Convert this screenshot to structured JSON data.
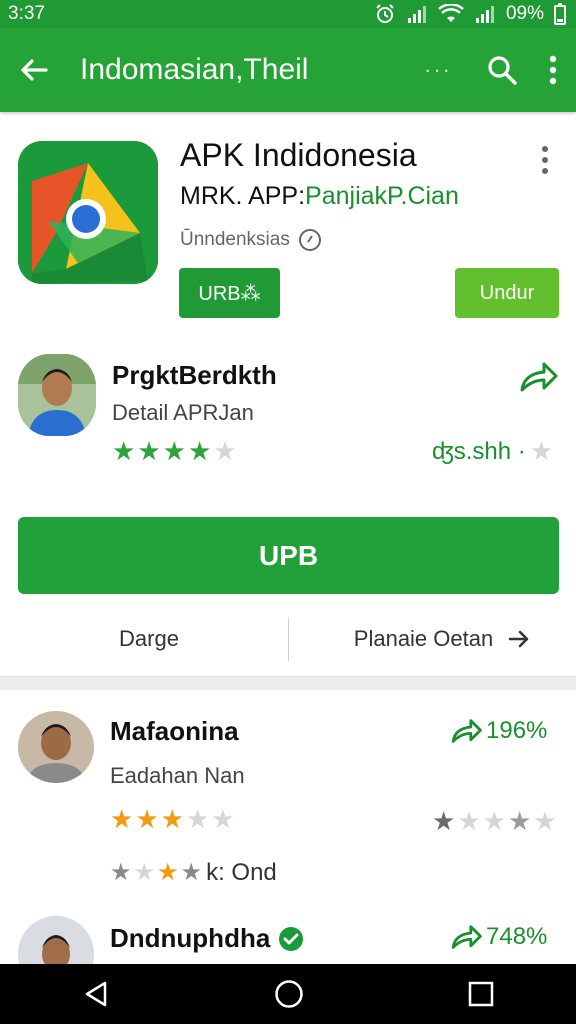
{
  "status": {
    "time": "3:37",
    "battery": "09%"
  },
  "appbar": {
    "title": "Indomasian,Theil",
    "more_dots": "···",
    "icons": [
      "back-arrow-icon",
      "search-icon",
      "overflow-menu-icon"
    ]
  },
  "app": {
    "title": "APK Indidonesia",
    "subtitle_prefix": "MRK. APP:",
    "subtitle_suffix": "PanjiakP.Cian",
    "meta": "Ūnndenksias",
    "button_left": "URB⁂",
    "button_right": "Undur",
    "colors": {
      "green_dark": "#1f9a35",
      "green_light": "#62bf2e"
    }
  },
  "featured": {
    "name": "PrgktBerdkth",
    "detail": "Detail APRJan",
    "rating": 4,
    "side_text": "ʤs.shh ·",
    "primary_button": "UPB"
  },
  "links": {
    "left": "Darge",
    "right": "Planaie Oetan"
  },
  "reviews": [
    {
      "name": "Mafaonina",
      "sub": "Eadahan Nan",
      "percent": "196%",
      "rating": 3,
      "extra_text": "k: Ond"
    },
    {
      "name": "Dndnuphdha",
      "percent": "748%",
      "verified": true
    }
  ]
}
